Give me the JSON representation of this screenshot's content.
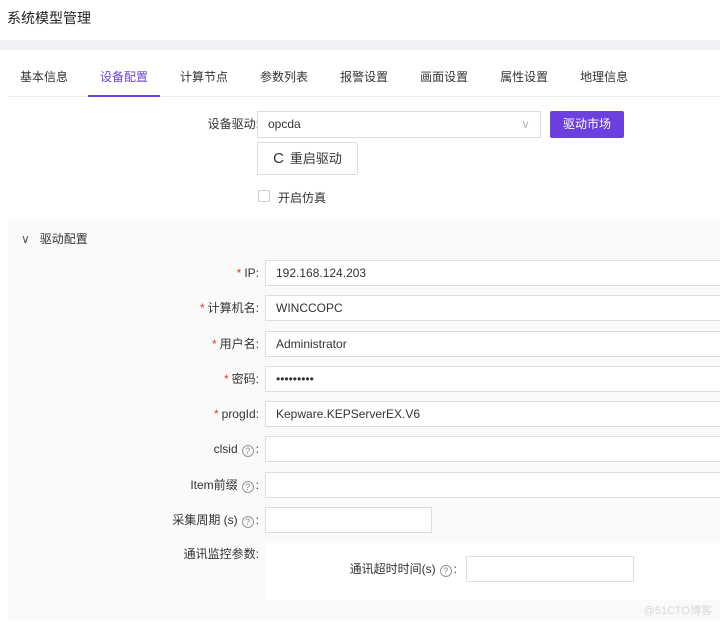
{
  "title": "系统模型管理",
  "tabs": [
    "基本信息",
    "设备配置",
    "计算节点",
    "参数列表",
    "报警设置",
    "画面设置",
    "属性设置",
    "地理信息"
  ],
  "driver": {
    "label": "设备驱动:",
    "value": "opcda",
    "market_button": "驱动市场",
    "restart_button": "重启驱动",
    "simulate_label": "开启仿真"
  },
  "section": {
    "title": "驱动配置"
  },
  "fields": [
    {
      "label": "IP:",
      "value": "192.168.124.203",
      "required": true
    },
    {
      "label": "计算机名:",
      "value": "WINCCOPC",
      "required": true
    },
    {
      "label": "用户名:",
      "value": "Administrator",
      "required": true
    },
    {
      "label": "密码:",
      "value": "•••••••••",
      "required": true
    },
    {
      "label": "progId:",
      "value": "Kepware.KEPServerEX.V6",
      "required": true
    },
    {
      "label": "clsid",
      "value": "",
      "help": true
    },
    {
      "label": "Item前缀",
      "value": "",
      "help": true
    },
    {
      "label": "采集周期 (s)",
      "value": "",
      "help": true
    }
  ],
  "monitor": {
    "label": "通讯监控参数:",
    "timeout_label": "通讯超时时间(s)",
    "timeout_value": ""
  },
  "req_mark": "*",
  "help_glyph": "?",
  "colon": ":",
  "watermark": "@51CTO博客"
}
